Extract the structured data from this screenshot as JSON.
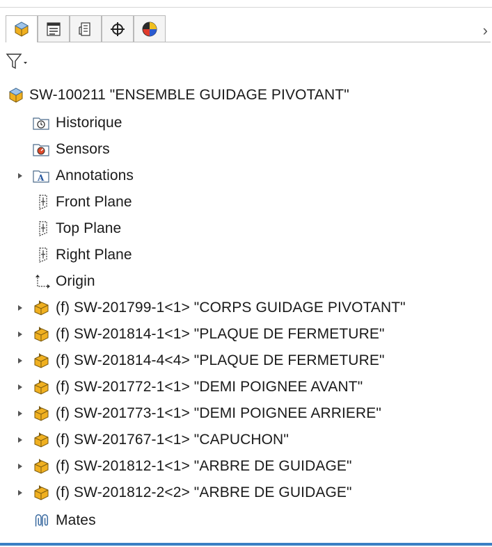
{
  "tabs": [
    {
      "name": "tab-featuremanager",
      "icon": "assembly-cube-icon"
    },
    {
      "name": "tab-propertymanager",
      "icon": "property-list-icon"
    },
    {
      "name": "tab-configurationmanager",
      "icon": "configuration-icon"
    },
    {
      "name": "tab-dimxpertmanager",
      "icon": "crosshair-icon"
    },
    {
      "name": "tab-displaymanager",
      "icon": "display-pie-icon"
    }
  ],
  "colors": {
    "accent": "#3a7fc4",
    "part_icon": "#f0b020",
    "folder_icon": "#4a6a8a"
  },
  "tree": {
    "root": {
      "label": "SW-100211 \"ENSEMBLE GUIDAGE PIVOTANT\"",
      "icon": "assembly-icon"
    },
    "items": [
      {
        "label": "Historique",
        "icon": "history-folder-icon",
        "expandable": false
      },
      {
        "label": "Sensors",
        "icon": "sensors-folder-icon",
        "expandable": false
      },
      {
        "label": "Annotations",
        "icon": "annotations-folder-icon",
        "expandable": true
      },
      {
        "label": "Front Plane",
        "icon": "plane-icon",
        "expandable": false
      },
      {
        "label": "Top Plane",
        "icon": "plane-icon",
        "expandable": false
      },
      {
        "label": "Right Plane",
        "icon": "plane-icon",
        "expandable": false
      },
      {
        "label": "Origin",
        "icon": "origin-icon",
        "expandable": false
      },
      {
        "label": "(f) SW-201799-1<1> \"CORPS GUIDAGE PIVOTANT\"",
        "icon": "part-icon",
        "expandable": true
      },
      {
        "label": "(f) SW-201814-1<1> \"PLAQUE DE FERMETURE\"",
        "icon": "part-icon",
        "expandable": true
      },
      {
        "label": "(f) SW-201814-4<4> \"PLAQUE DE FERMETURE\"",
        "icon": "part-icon",
        "expandable": true
      },
      {
        "label": "(f) SW-201772-1<1> \"DEMI POIGNEE AVANT\"",
        "icon": "part-icon",
        "expandable": true
      },
      {
        "label": "(f) SW-201773-1<1> \"DEMI POIGNEE ARRIERE\"",
        "icon": "part-icon",
        "expandable": true
      },
      {
        "label": "(f) SW-201767-1<1> \"CAPUCHON\"",
        "icon": "part-icon",
        "expandable": true
      },
      {
        "label": "(f) SW-201812-1<1> \"ARBRE DE GUIDAGE\"",
        "icon": "part-icon",
        "expandable": true
      },
      {
        "label": "(f) SW-201812-2<2> \"ARBRE DE GUIDAGE\"",
        "icon": "part-icon",
        "expandable": true
      },
      {
        "label": "Mates",
        "icon": "mates-icon",
        "expandable": false
      }
    ]
  }
}
